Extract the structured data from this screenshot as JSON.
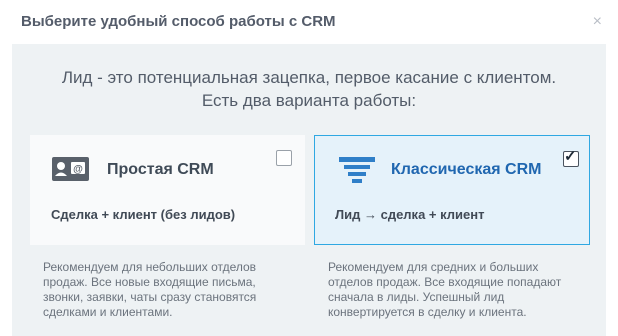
{
  "dialog": {
    "title": "Выберите удобный способ работы с CRM",
    "close_glyph": "×"
  },
  "intro": {
    "line1": "Лид - это потенциальная зацепка, первое касание с клиентом.",
    "line2": "Есть два варианта работы:"
  },
  "options": [
    {
      "title": "Простая CRM",
      "subtitle": "Сделка + клиент (без лидов)",
      "description": "Рекомендуем для небольших отделов продаж. Все новые входящие письма, звонки, заявки, чаты сразу становятся сделками и клиентами.",
      "checked": false,
      "icon": "contact-card-icon"
    },
    {
      "title": "Классическая CRM",
      "subtitle": "Лид → сделка + клиент",
      "description": "Рекомендуем для средних и больших отделов продаж. Все входящие попадают сначала в лиды. Успешный лид конвертируется в сделку и клиента.",
      "checked": true,
      "check_glyph": "✓",
      "icon": "funnel-icon"
    }
  ],
  "colors": {
    "accent": "#2fa8e2",
    "selected_title": "#2067b0",
    "funnel": "#2f7fc8"
  }
}
